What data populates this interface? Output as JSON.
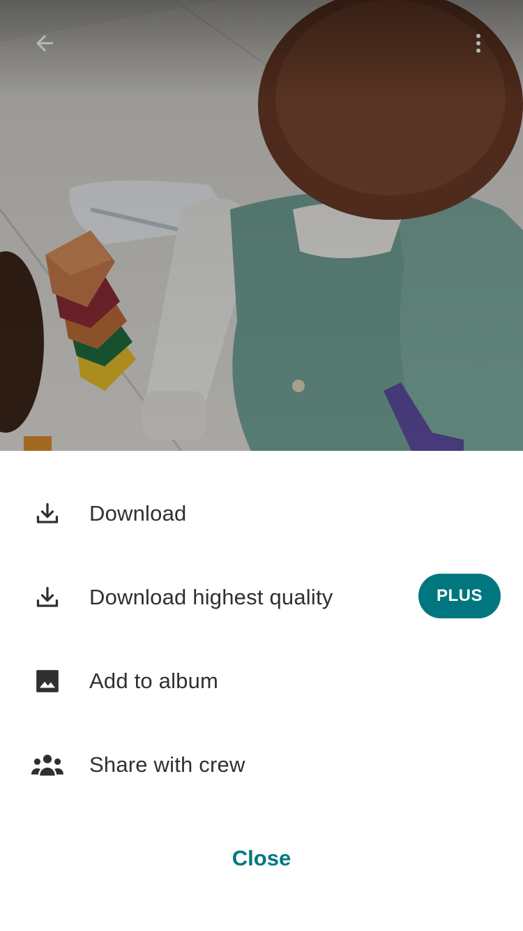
{
  "header": {
    "back_icon": "arrow-back-icon",
    "more_icon": "more-vert-icon"
  },
  "photo": {
    "description_icon": "photo"
  },
  "menu": {
    "items": [
      {
        "label": "Download",
        "icon": "download-icon"
      },
      {
        "label": "Download highest quality",
        "icon": "download-icon",
        "badge": "PLUS"
      },
      {
        "label": "Add to album",
        "icon": "image-icon"
      },
      {
        "label": "Share with crew",
        "icon": "group-icon"
      }
    ],
    "close_label": "Close"
  },
  "colors": {
    "accent": "#00777f",
    "text": "#303030",
    "icon": "#303030"
  }
}
